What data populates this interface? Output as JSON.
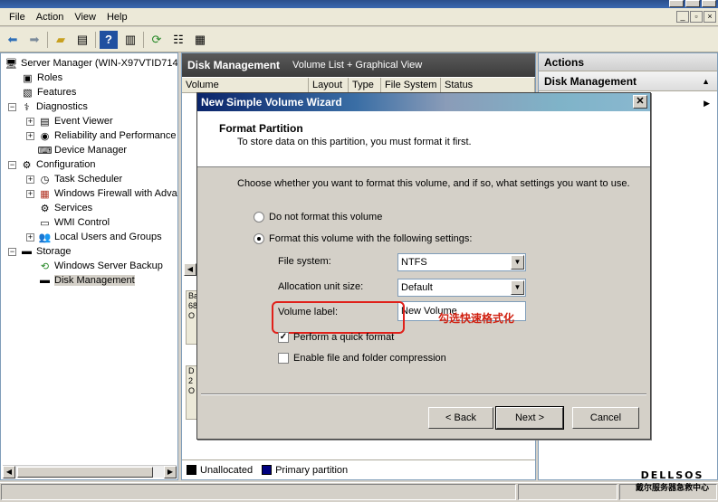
{
  "window": {
    "title": ""
  },
  "menu": [
    "File",
    "Action",
    "View",
    "Help"
  ],
  "toolbar": {
    "icons": [
      "back-icon",
      "forward-icon",
      "up-folder-icon",
      "show-hide-tree-icon",
      "help-icon",
      "action-pane-icon",
      "refresh-icon",
      "properties-icon",
      "export-icon"
    ]
  },
  "tree": {
    "root": "Server Manager (WIN-X97VTID714",
    "roles": "Roles",
    "features": "Features",
    "diagnostics": "Diagnostics",
    "event_viewer": "Event Viewer",
    "reliability": "Reliability and Performance",
    "device_manager": "Device Manager",
    "configuration": "Configuration",
    "task_scheduler": "Task Scheduler",
    "firewall": "Windows Firewall with Adva",
    "services": "Services",
    "wmi": "WMI Control",
    "local_users": "Local Users and Groups",
    "storage": "Storage",
    "backup": "Windows Server Backup",
    "disk_mgmt": "Disk Management"
  },
  "center": {
    "title": "Disk Management",
    "subtitle": "Volume List + Graphical View",
    "columns": [
      "Volume",
      "Layout",
      "Type",
      "File System",
      "Status"
    ],
    "disk0_lines": [
      "Ba",
      "68",
      "O"
    ],
    "disk1_lines": [
      "D",
      "2",
      "O"
    ],
    "legend": {
      "unallocated": "Unallocated",
      "primary": "Primary partition",
      "unallocated_color": "#000000",
      "primary_color": "#00007f"
    }
  },
  "actions": {
    "header": "Actions",
    "section": "Disk Management"
  },
  "dialog": {
    "title": "New Simple Volume Wizard",
    "heading": "Format Partition",
    "subheading": "To store data on this partition, you must format it first.",
    "instruction": "Choose whether you want to format this volume, and if so, what settings you want to use.",
    "opt_no_format": "Do not format this volume",
    "opt_format": "Format this volume with the following settings:",
    "fs_label": "File system:",
    "fs_value": "NTFS",
    "alloc_label": "Allocation unit size:",
    "alloc_value": "Default",
    "vol_label": "Volume label:",
    "vol_value": "New Volume",
    "quick_format": "Perform a quick format",
    "compression": "Enable file and folder compression",
    "annotation": "勾选快速格式化",
    "back": "< Back",
    "next": "Next >",
    "cancel": "Cancel",
    "accent_color": "#e0201a"
  },
  "watermark": {
    "brand": "DELLSOS",
    "tagline": "戴尔服务器急救中心"
  }
}
